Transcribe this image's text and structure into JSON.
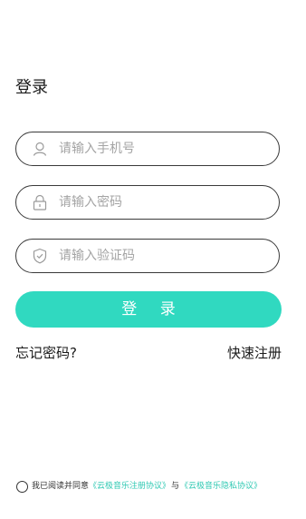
{
  "page": {
    "title": "登录"
  },
  "form": {
    "phone_placeholder": "请输入手机号",
    "password_placeholder": "请输入密码",
    "code_placeholder": "请输入验证码",
    "login_label": "登 录"
  },
  "links": {
    "forgot_password": "忘记密码?",
    "quick_register": "快速注册"
  },
  "agreement": {
    "prefix": "我已阅读并同意",
    "terms_link": "《云极音乐注册协议》",
    "and": "与",
    "privacy_link": "《云极音乐隐私协议》"
  },
  "icons": {
    "phone_field": "user-icon",
    "password_field": "lock-icon",
    "code_field": "shield-icon"
  },
  "colors": {
    "accent": "#30d9c0",
    "link": "#30c9b3",
    "field_border": "#3a3a3a",
    "placeholder": "#a4a4a4"
  }
}
